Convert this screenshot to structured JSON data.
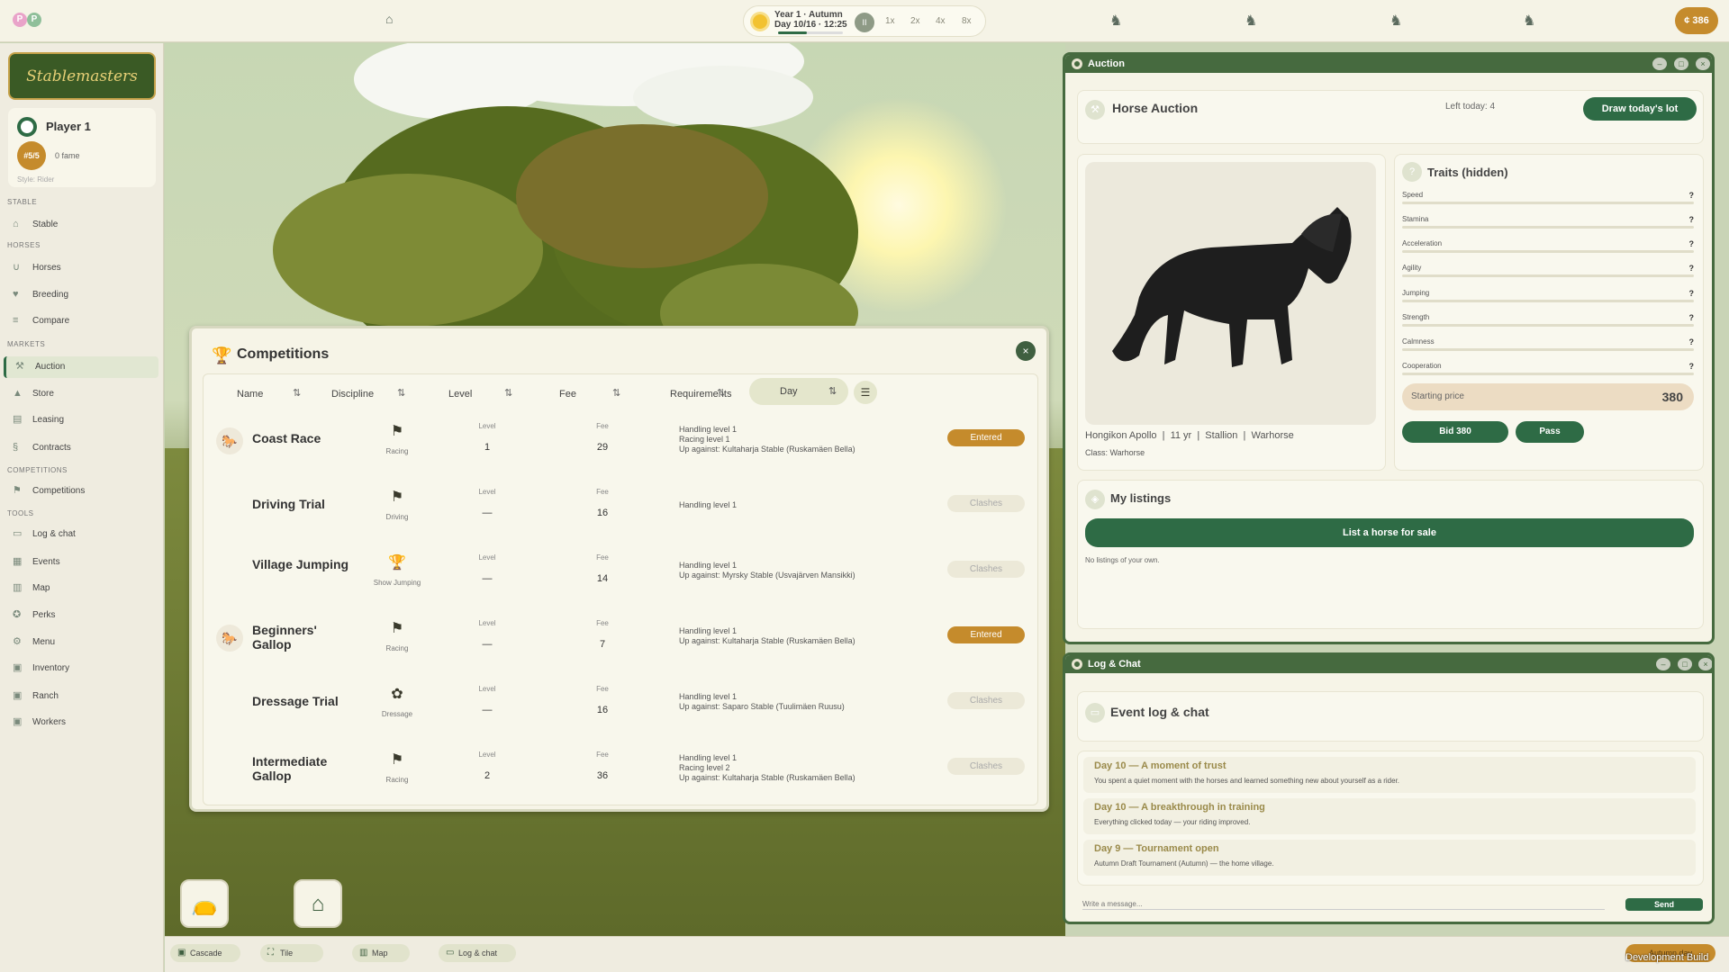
{
  "topbar": {
    "time_line1": "Year 1 · Autumn",
    "time_line2": "Day 10/16 · 12:25",
    "day_progress": 0.45,
    "pause_label": "II",
    "speeds": [
      "1x",
      "2x",
      "4x",
      "8x"
    ],
    "money": "¢ 386",
    "colors": {
      "accent": "#2e6b45",
      "gold": "#c58b2c"
    }
  },
  "sidebar": {
    "logo_text": "Stablemasters",
    "player": {
      "name": "Player 1",
      "rank": "#5/5",
      "fame": "0 fame",
      "style": "Style: Rider"
    },
    "sections": {
      "stable": "STABLE",
      "horses": "HORSES",
      "markets": "MARKETS",
      "competitions": "COMPETITIONS",
      "tools": "TOOLS"
    },
    "items": {
      "stable": "Stable",
      "horses": "Horses",
      "breeding": "Breeding",
      "compare": "Compare",
      "auction": "Auction",
      "store": "Store",
      "leasing": "Leasing",
      "contracts": "Contracts",
      "competitions": "Competitions",
      "log": "Log & chat",
      "events": "Events",
      "map": "Map",
      "perks": "Perks",
      "menu": "Menu",
      "inventory": "Inventory",
      "ranch": "Ranch",
      "workers": "Workers"
    }
  },
  "competitions": {
    "title": "Competitions",
    "close": "×",
    "headers": {
      "name": "Name",
      "discipline": "Discipline",
      "level": "Level",
      "fee": "Fee",
      "requirements": "Requirements",
      "day": "Day"
    },
    "level_label": "Level",
    "fee_label": "Fee",
    "rows": [
      {
        "name": "Coast Race",
        "discipline": "Racing",
        "level": "1",
        "fee": "29",
        "req1": "Handling level 1",
        "req2": "Racing level 1",
        "req3": "Up against: Kultaharja Stable (Ruskamäen Bella)",
        "status": "Entered"
      },
      {
        "name": "Driving Trial",
        "discipline": "Driving",
        "level": "—",
        "fee": "16",
        "req1": "Handling level 1",
        "req2": "",
        "req3": "",
        "status": "Clashes"
      },
      {
        "name": "Village Jumping",
        "discipline": "Show Jumping",
        "level": "—",
        "fee": "14",
        "req1": "Handling level 1",
        "req2": "Up against: Myrsky Stable (Usvajärven Mansikki)",
        "req3": "",
        "status": "Clashes"
      },
      {
        "name": "Beginners' Gallop",
        "discipline": "Racing",
        "level": "—",
        "fee": "7",
        "req1": "Handling level 1",
        "req2": "Up against: Kultaharja Stable (Ruskamäen Bella)",
        "req3": "",
        "status": "Entered"
      },
      {
        "name": "Dressage Trial",
        "discipline": "Dressage",
        "level": "—",
        "fee": "16",
        "req1": "Handling level 1",
        "req2": "Up against: Saparo Stable (Tuulimäen Ruusu)",
        "req3": "",
        "status": "Clashes"
      },
      {
        "name": "Intermediate Gallop",
        "discipline": "Racing",
        "level": "2",
        "fee": "36",
        "req1": "Handling level 1",
        "req2": "Racing level 2",
        "req3": "Up against: Kultaharja Stable (Ruskamäen Bella)",
        "status": "Clashes"
      }
    ]
  },
  "auction": {
    "window_title": "Auction",
    "title": "Horse Auction",
    "left_today": "Left today: 4",
    "draw_button": "Draw today's lot",
    "horse_info": "Hongikon Apollo  |  11 yr  |  Stallion  |  Warhorse",
    "horse_class": "Class: Warhorse",
    "traits_title": "Traits (hidden)",
    "traits": [
      "Speed",
      "Stamina",
      "Acceleration",
      "Agility",
      "Jumping",
      "Strength",
      "Calmness",
      "Cooperation"
    ],
    "trait_value": "?",
    "starting_price_label": "Starting price",
    "starting_price": "380",
    "bid_button": "Bid 380",
    "pass_button": "Pass",
    "listings_title": "My listings",
    "list_button": "List a horse for sale",
    "no_listings": "No listings of your own."
  },
  "log": {
    "window_title": "Log & Chat",
    "title": "Event log & chat",
    "entries": [
      {
        "head": "Day 10  —  A moment of trust",
        "body": "You spent a quiet moment with the horses and learned something new about yourself as a rider."
      },
      {
        "head": "Day 10  —  A breakthrough in training",
        "body": "Everything clicked today — your riding improved."
      },
      {
        "head": "Day 9  —  Tournament open",
        "body": "Autumn Draft Tournament (Autumn) — the home village."
      }
    ],
    "input_placeholder": "Write a message...",
    "send": "Send"
  },
  "bottombar": {
    "cascade": "Cascade",
    "tile": "Tile",
    "map": "Map",
    "log": "Log & chat",
    "autumn": "Autumn day",
    "dev": "Development Build"
  }
}
